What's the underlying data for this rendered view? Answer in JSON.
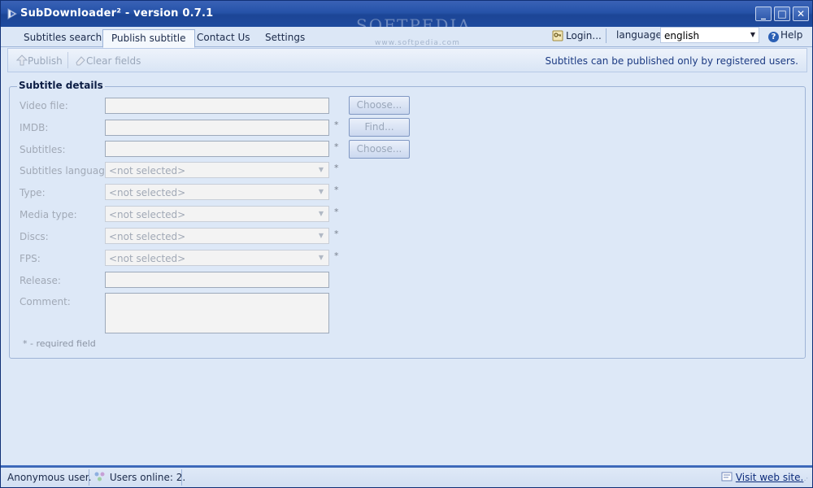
{
  "window": {
    "title": "SubDownloader² - version 0.7.1",
    "watermark": "SOFTPEDIA",
    "watermark_sub": "www.softpedia.com",
    "controls": {
      "minimize": "_",
      "maximize": "□",
      "close": "✕"
    }
  },
  "tabs": [
    {
      "label": "Subtitles search",
      "active": false
    },
    {
      "label": "Publish subtitle",
      "active": true
    },
    {
      "label": "Contact Us",
      "active": false
    },
    {
      "label": "Settings",
      "active": false
    }
  ],
  "header": {
    "login_label": "Login...",
    "language_label": "language:",
    "language_value": "english",
    "help_label": "Help"
  },
  "toolbar": {
    "publish_label": "Publish",
    "clear_label": "Clear fields",
    "notice": "Subtitles can be published only by registered users."
  },
  "form": {
    "group_title": "Subtitle details",
    "video_file_label": "Video file:",
    "imdb_label": "IMDB:",
    "subtitles_label": "Subtitles:",
    "subtitles_language_label": "Subtitles language:",
    "type_label": "Type:",
    "media_type_label": "Media type:",
    "discs_label": "Discs:",
    "fps_label": "FPS:",
    "release_label": "Release:",
    "comment_label": "Comment:",
    "not_selected": "<not selected>",
    "required_mark": "*",
    "required_note": "*   - required field",
    "choose_label": "Choose...",
    "find_label": "Find..."
  },
  "status": {
    "user": "Anonymous user.",
    "online": "Users online: 2.",
    "website": "Visit web site."
  }
}
